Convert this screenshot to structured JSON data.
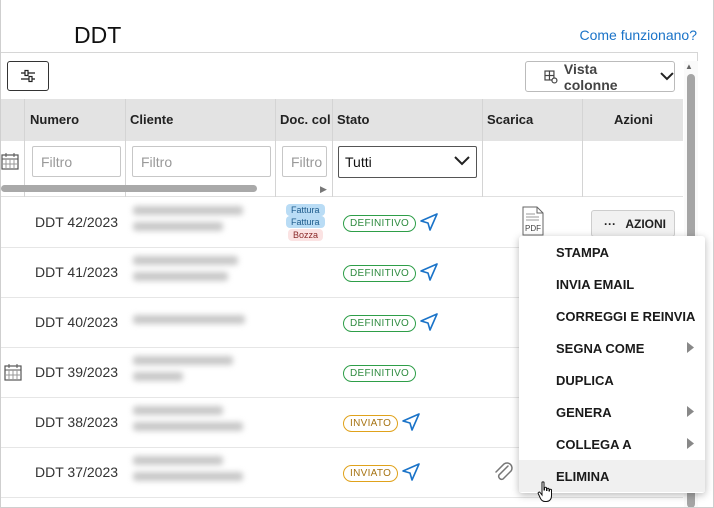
{
  "page": {
    "title": "DDT",
    "help_link": "Come funzionano?"
  },
  "toolbar": {
    "columns_button_label": "Vista colonne"
  },
  "table": {
    "headers": {
      "numero": "Numero",
      "cliente": "Cliente",
      "doc_coll": "Doc. col",
      "stato": "Stato",
      "scarica": "Scarica",
      "azioni": "Azioni"
    },
    "filters": {
      "numero_placeholder": "Filtro",
      "cliente_placeholder": "Filtro",
      "doc_placeholder": "Filtro",
      "stato_value": "Tutti"
    },
    "rows": [
      {
        "numero": "DDT 42/2023",
        "stato": "DEFINITIVO",
        "docs": [
          "Fattura",
          "Fattura",
          "Bozza"
        ]
      },
      {
        "numero": "DDT 41/2023",
        "stato": "DEFINITIVO"
      },
      {
        "numero": "DDT 40/2023",
        "stato": "DEFINITIVO"
      },
      {
        "numero": "DDT 39/2023",
        "stato": "DEFINITIVO"
      },
      {
        "numero": "DDT 38/2023",
        "stato": "INVIATO"
      },
      {
        "numero": "DDT 37/2023",
        "stato": "INVIATO"
      }
    ],
    "actions_button_label": "AZIONI",
    "pdf_label": "PDF"
  },
  "menu": {
    "items": [
      "STAMPA",
      "INVIA EMAIL",
      "CORREGGI E REINVIA",
      "SEGNA COME",
      "DUPLICA",
      "GENERA",
      "COLLEGA A",
      "ELIMINA"
    ]
  },
  "colors": {
    "link": "#1a73c8",
    "definitivo": "#2e9e48",
    "inviato": "#e0a21b",
    "header_bg": "#e3e3e3"
  }
}
